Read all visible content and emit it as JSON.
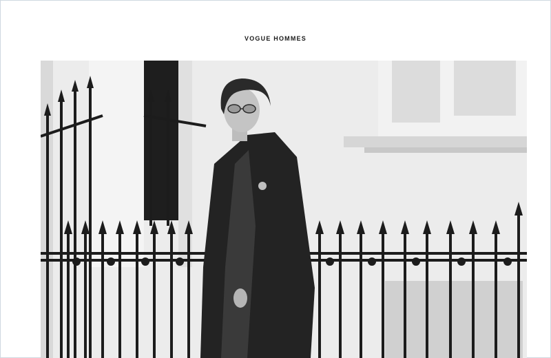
{
  "publication": {
    "title": "VOGUE HOMMES"
  },
  "photo": {
    "subject": "model-portrait",
    "style": "black-and-white",
    "colors": {
      "wall": "#e9e9e9",
      "shadow": "#cfcfcf",
      "railing": "#1c1c1c",
      "coat": "#232323",
      "suit": "#3a3a3a",
      "skin": "#bdbdbd",
      "hair": "#2a2a2a"
    }
  }
}
